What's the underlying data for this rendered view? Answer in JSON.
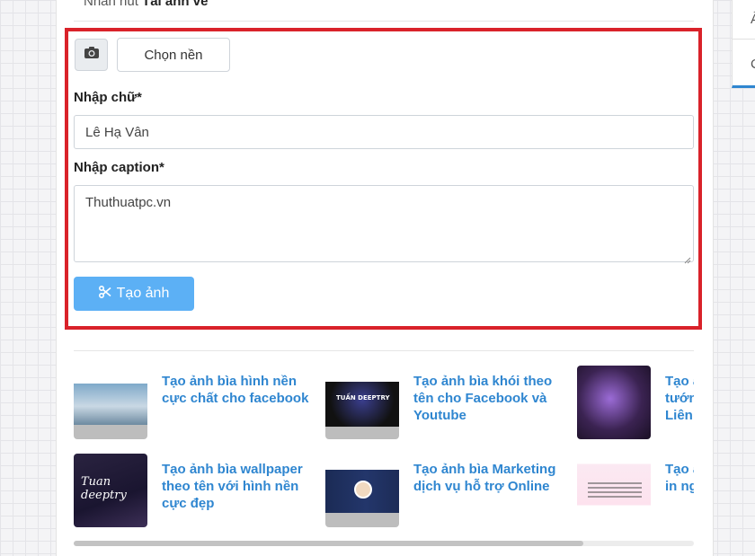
{
  "top": {
    "prefix": "Nhấn nút ",
    "bold": "Tải ảnh về"
  },
  "form": {
    "choose_bg_label": "Chọn nền",
    "text_label": "Nhập chữ*",
    "text_value": "Lê Hạ Vân",
    "caption_label": "Nhập caption*",
    "caption_value": "Thuthuatpc.vn",
    "create_label": "Tạo ảnh"
  },
  "related": [
    {
      "title": "Tạo ảnh bìa hình nền\ncực chất cho facebook"
    },
    {
      "title": "Tạo ảnh bìa khói theo\ntên cho Facebook và\nYoutube"
    },
    {
      "title": "Tạo ảnh\ntướng\nLiên"
    },
    {
      "title": "Tạo ảnh bìa wallpaper\ntheo tên với hình nền\ncực đẹp"
    },
    {
      "title": "Tạo ảnh bìa Marketing\ndịch vụ hỗ trợ Online"
    },
    {
      "title": "Tạo ảnh\nin ng"
    }
  ],
  "thumb_text": {
    "b": "TUẤN DEEPTRY",
    "d": "Tuan deeptry"
  },
  "right_panel": {
    "row1": "Ả",
    "row2": "C"
  },
  "colors": {
    "highlight": "#d9222a",
    "primary": "#5cb0f5",
    "link": "#2f86d0"
  },
  "icons": {
    "camera": "camera-icon",
    "create": "scissors-icon"
  }
}
